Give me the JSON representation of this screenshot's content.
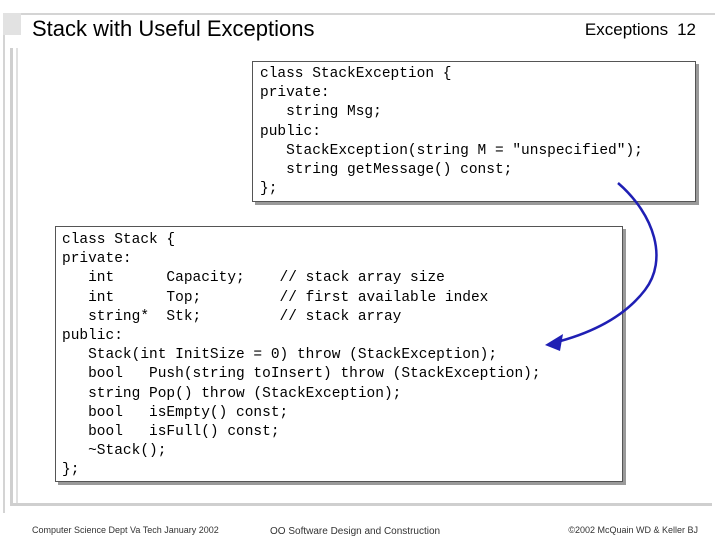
{
  "slide": {
    "title": "Stack with Useful Exceptions",
    "section": "Exceptions",
    "number": "12"
  },
  "code_blocks": {
    "exception_class": {
      "lines": [
        "class StackException {",
        "private:",
        "   string Msg;",
        "public:",
        "   StackException(string M = \"unspecified\");",
        "   string getMessage() const;",
        "};"
      ]
    },
    "stack_class": {
      "lines": [
        "class Stack {",
        "private:",
        "   int      Capacity;    // stack array size",
        "   int      Top;         // first available index",
        "   string*  Stk;         // stack array",
        "public:",
        "   Stack(int InitSize = 0) throw (StackException);",
        "   bool   Push(string toInsert) throw (StackException);",
        "   string Pop() throw (StackException);",
        "   bool   isEmpty() const;",
        "   bool   isFull() const;",
        "   ~Stack();",
        "};"
      ]
    }
  },
  "footer": {
    "left": "Computer Science Dept Va Tech January 2002",
    "center": "OO Software Design and Construction",
    "right": "©2002  McQuain WD & Keller BJ"
  },
  "colors": {
    "arrow": "#1f1fb4"
  }
}
